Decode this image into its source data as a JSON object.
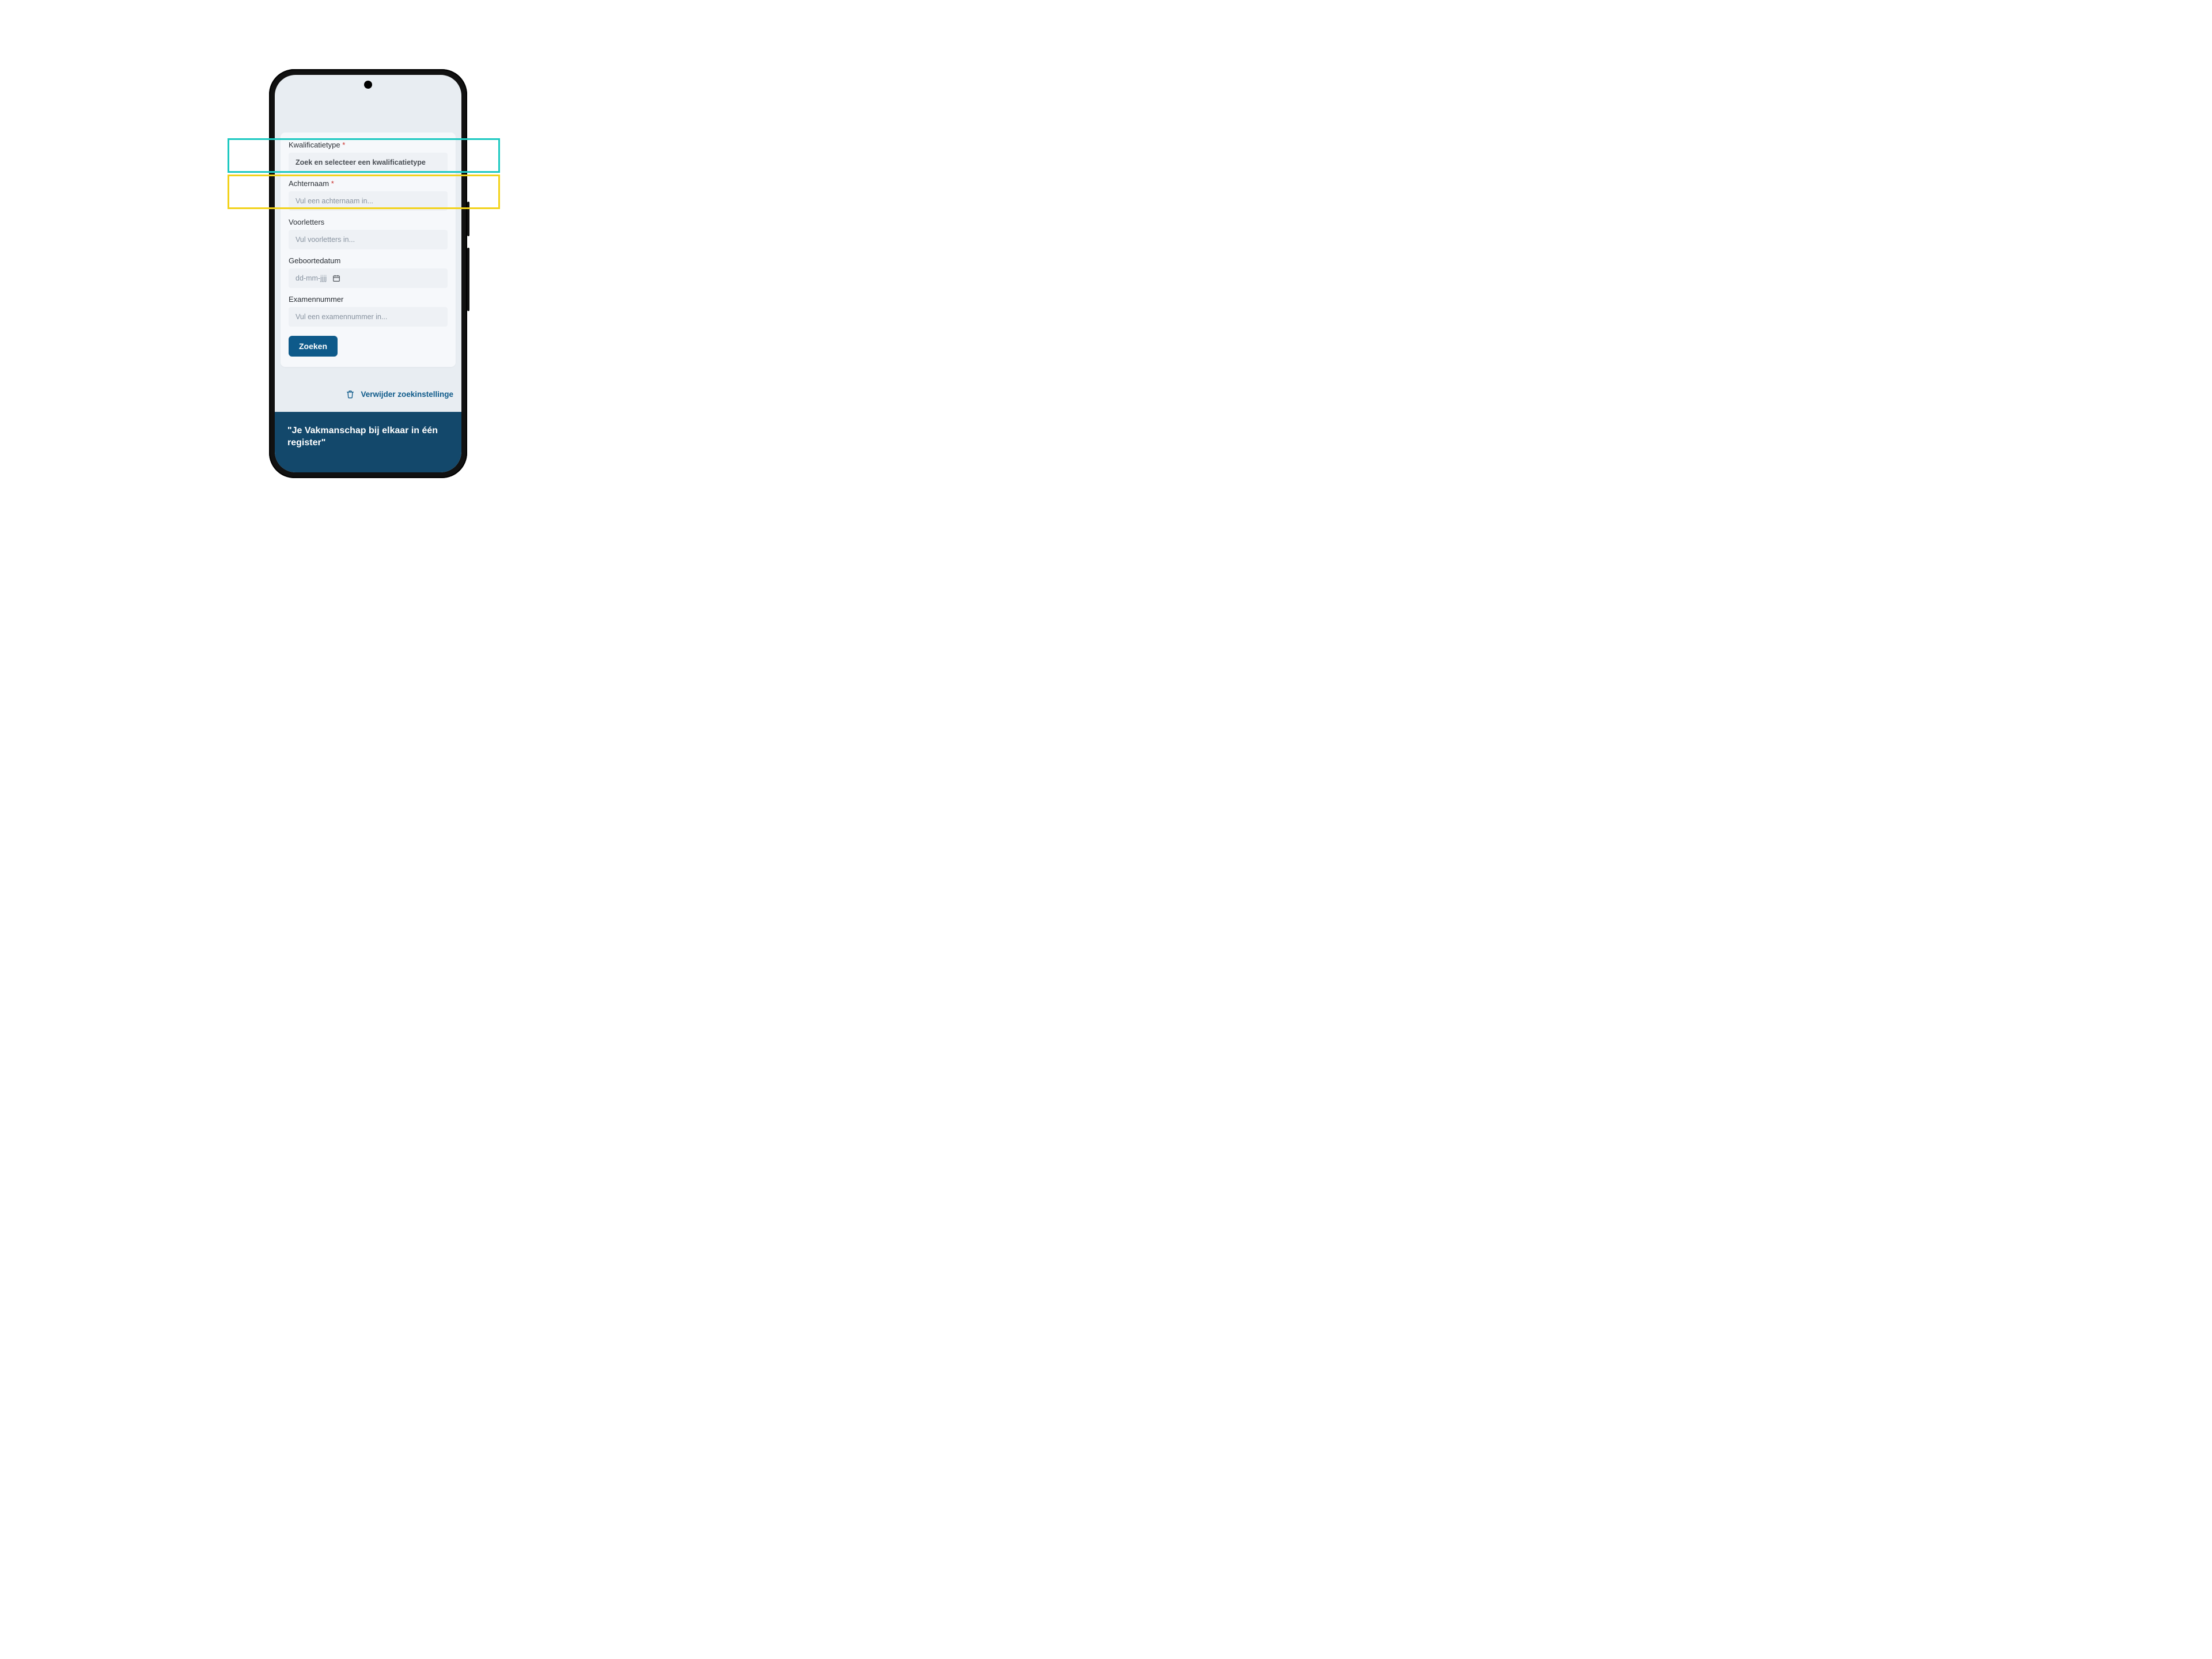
{
  "form": {
    "kwalificatietype": {
      "label": "Kwalificatietype",
      "required": "*",
      "placeholder": "Zoek en selecteer een kwalificatietype"
    },
    "achternaam": {
      "label": "Achternaam",
      "required": "*",
      "placeholder": "Vul een achternaam in..."
    },
    "voorletters": {
      "label": "Voorletters",
      "placeholder": "Vul voorletters in..."
    },
    "geboortedatum": {
      "label": "Geboortedatum",
      "placeholder": "dd-mm-jjjj"
    },
    "examennummer": {
      "label": "Examennummer",
      "placeholder": "Vul een examennummer in..."
    },
    "submit_label": "Zoeken",
    "clear_label": "Verwijder zoekinstellinge"
  },
  "footer": {
    "quote": "\"Je Vakmanschap bij elkaar in één register\""
  },
  "overlays": {
    "teal_box": "highlight-kwalificatietype",
    "yellow_box": "highlight-achternaam"
  }
}
